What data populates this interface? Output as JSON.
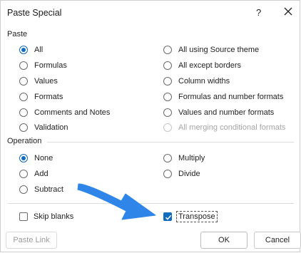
{
  "dialog": {
    "title": "Paste Special",
    "help_label": "?"
  },
  "paste": {
    "label": "Paste",
    "options": [
      {
        "label": "All",
        "selected": true
      },
      {
        "label": "Formulas"
      },
      {
        "label": "Values"
      },
      {
        "label": "Formats"
      },
      {
        "label": "Comments and Notes"
      },
      {
        "label": "Validation"
      },
      {
        "label": "All using Source theme"
      },
      {
        "label": "All except borders"
      },
      {
        "label": "Column widths"
      },
      {
        "label": "Formulas and number formats"
      },
      {
        "label": "Values and number formats"
      },
      {
        "label": "All merging conditional formats",
        "disabled": true
      }
    ]
  },
  "operation": {
    "label": "Operation",
    "options": [
      {
        "label": "None",
        "selected": true
      },
      {
        "label": "Add"
      },
      {
        "label": "Subtract"
      },
      {
        "label": "Multiply"
      },
      {
        "label": "Divide"
      }
    ]
  },
  "checks": {
    "skip_blanks": {
      "label": "Skip blanks",
      "checked": false
    },
    "transpose": {
      "label": "Transpose",
      "checked": true
    }
  },
  "buttons": {
    "paste_link": "Paste Link",
    "ok": "OK",
    "cancel": "Cancel"
  },
  "colors": {
    "accent": "#0f6cbd",
    "arrow": "#2f86e8"
  }
}
